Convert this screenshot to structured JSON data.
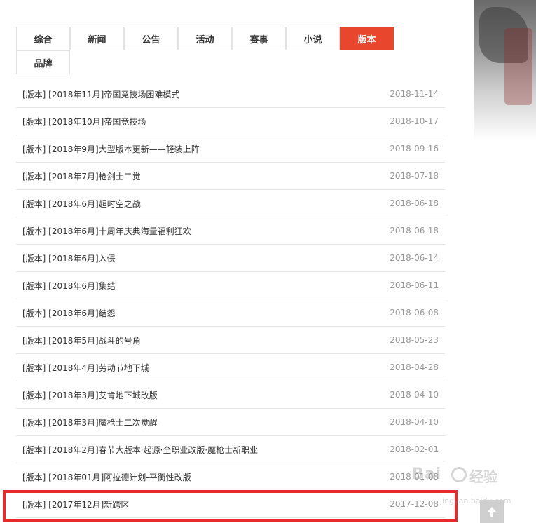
{
  "tabs": [
    {
      "label": "综合",
      "active": false
    },
    {
      "label": "新闻",
      "active": false
    },
    {
      "label": "公告",
      "active": false
    },
    {
      "label": "活动",
      "active": false
    },
    {
      "label": "赛事",
      "active": false
    },
    {
      "label": "小说",
      "active": false
    },
    {
      "label": "版本",
      "active": true
    },
    {
      "label": "品牌",
      "active": false
    }
  ],
  "articles": [
    {
      "title": "[版本] [2018年11月]帝国竞技场困难模式",
      "date": "2018-11-14"
    },
    {
      "title": "[版本] [2018年10月]帝国竞技场",
      "date": "2018-10-17"
    },
    {
      "title": "[版本] [2018年9月]大型版本更新——轻装上阵",
      "date": "2018-09-16"
    },
    {
      "title": "[版本] [2018年7月]枪剑士二觉",
      "date": "2018-07-18"
    },
    {
      "title": "[版本] [2018年6月]超时空之战",
      "date": "2018-06-18"
    },
    {
      "title": "[版本] [2018年6月]十周年庆典海量福利狂欢",
      "date": "2018-06-18"
    },
    {
      "title": "[版本] [2018年6月]入侵",
      "date": "2018-06-14"
    },
    {
      "title": "[版本] [2018年6月]集结",
      "date": "2018-06-11"
    },
    {
      "title": "[版本] [2018年6月]结怨",
      "date": "2018-06-08"
    },
    {
      "title": "[版本] [2018年5月]战斗的号角",
      "date": "2018-05-23"
    },
    {
      "title": "[版本] [2018年4月]劳动节地下城",
      "date": "2018-04-28"
    },
    {
      "title": "[版本] [2018年3月]艾肯地下城改版",
      "date": "2018-04-10"
    },
    {
      "title": "[版本] [2018年3月]魔枪士二次觉醒",
      "date": "2018-04-10"
    },
    {
      "title": "[版本] [2018年2月]春节大版本·起源·全职业改版·魔枪士新职业",
      "date": "2018-02-01"
    },
    {
      "title": "[版本] [2018年01月]阿拉德计划-平衡性改版",
      "date": "2018-01-08"
    },
    {
      "title": "[版本] [2017年12月]新跨区",
      "date": "2017-12-08"
    }
  ],
  "watermark": {
    "logo": "Bai",
    "brand": "经验",
    "url": "jingyan.baidu.com"
  },
  "colors": {
    "accent": "#e8472e",
    "highlight": "#e8292a",
    "date": "#999999"
  },
  "icons": {
    "back_to_top": "arrow-up-icon"
  }
}
